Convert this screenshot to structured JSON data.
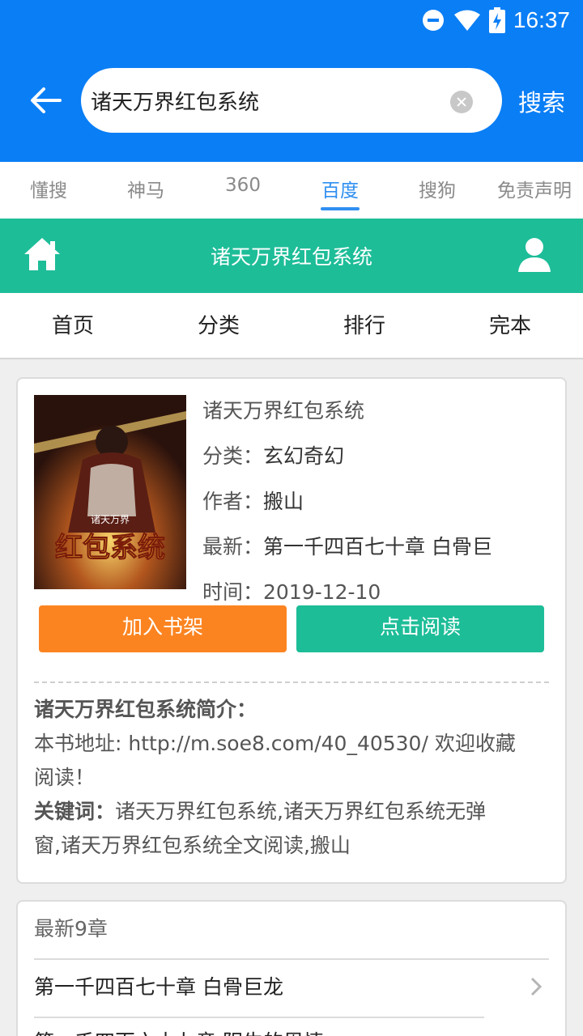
{
  "status_bar": {
    "time": "16:37"
  },
  "search": {
    "query": "诸天万界红包系统",
    "button_label": "搜索"
  },
  "engine_tabs": [
    {
      "label": "懂搜",
      "active": false
    },
    {
      "label": "神马",
      "active": false
    },
    {
      "label": "360",
      "active": false
    },
    {
      "label": "百度",
      "active": true
    },
    {
      "label": "搜狗",
      "active": false
    },
    {
      "label": "免责声明",
      "active": false
    }
  ],
  "site": {
    "title": "诸天万界红包系统",
    "nav": [
      "首页",
      "分类",
      "排行",
      "完本"
    ]
  },
  "book": {
    "title": "诸天万界红包系统",
    "category_label": "分类：",
    "category": "玄幻奇幻",
    "author_label": "作者：",
    "author": "搬山",
    "latest_label": "最新：",
    "latest": "第一千四百七十章 白骨巨",
    "time_label": "时间：",
    "time": "2019-12-10",
    "add_shelf_label": "加入书架",
    "read_label": "点击阅读",
    "intro_heading": "诸天万界红包系统简介：",
    "address_line1": "本书地址: http://m.soe8.com/40_40530/ 欢迎收藏",
    "address_line2": "阅读！",
    "keywords_label": "关键词：",
    "keywords_line1": "诸天万界红包系统,诸天万界红包系统无弹",
    "keywords_line2": "窗,诸天万界红包系统全文阅读,搬山",
    "cover_text_small": "诸天万界",
    "cover_text_big": "红包系统"
  },
  "chapters": {
    "heading": "最新9章",
    "items": [
      "第一千四百七十章 白骨巨龙",
      "第一千四百六十九章 阴牛的恩情"
    ]
  },
  "colors": {
    "app_bar": "#0a7ef5",
    "site_bar": "#1dbd98",
    "tab_active": "#2f8ff0",
    "shelf_button": "#fb8421",
    "read_button": "#1dbd98"
  },
  "icons": [
    "minus-circle-icon",
    "wifi-icon",
    "battery-charging-icon",
    "back-arrow-icon",
    "clear-icon",
    "home-icon",
    "user-icon",
    "chevron-right-icon"
  ]
}
